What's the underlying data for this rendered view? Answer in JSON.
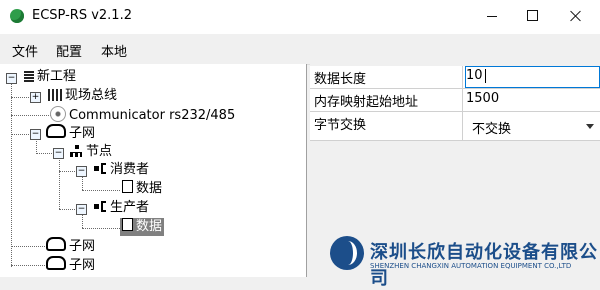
{
  "window": {
    "title": "ECSP-RS v2.1.2"
  },
  "menu": [
    "文件",
    "配置",
    "本地"
  ],
  "tree": {
    "root": "新工程",
    "fieldbus": "现场总线",
    "communicator": "Communicator rs232/485",
    "subnet1": "子网",
    "node": "节点",
    "consumer": "消费者",
    "consumer_data": "数据",
    "producer": "生产者",
    "producer_data": "数据",
    "subnet2": "子网",
    "subnet3": "子网",
    "toggle_expanded": "−",
    "toggle_collapsed": "+"
  },
  "properties": [
    {
      "name": "数据长度",
      "value": "10"
    },
    {
      "name": "内存映射起始地址",
      "value": "1500"
    },
    {
      "name": "字节交换",
      "value": "不交换"
    }
  ],
  "watermark": {
    "cn": "深圳长欣自动化设备有限公司",
    "en": "SHENZHEN CHANGXIN AUTOMATION EQUIPMENT CO.,LTD"
  }
}
